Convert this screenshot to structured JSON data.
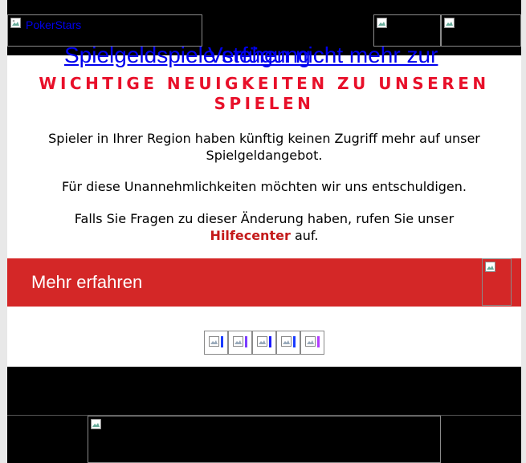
{
  "header": {
    "logo_alt": "PokerStars",
    "overlap_link_a": "Spielgeldspiele stehen nicht mehr zur",
    "overlap_link_b": "Verfügung"
  },
  "content": {
    "headline": "WICHTIGE NEUIGKEITEN ZU UNSEREN SPIELEN",
    "paragraph1": "Spieler in Ihrer Region haben künftig keinen Zugriff mehr auf unser Spielgeldangebot.",
    "paragraph2": "Für diese Unannehmlichkeiten möchten wir uns entschuldigen.",
    "paragraph3_before": "Falls Sie Fragen zu dieser Änderung haben, rufen Sie unser",
    "help_link": "Hilfecenter",
    "paragraph3_after": "auf."
  },
  "cta": {
    "label": "Mehr erfahren"
  },
  "social": {
    "icons": [
      "facebook-icon",
      "twitter-icon",
      "youtube-icon",
      "instagram-icon",
      "twitch-icon"
    ],
    "tail_colors": [
      "#1a3cff",
      "#7a3cff",
      "#1a1aff",
      "#1a3cff",
      "#b03cff"
    ]
  },
  "colors": {
    "accent_red": "#d42727",
    "headline_red": "#e8102a",
    "link_blue": "#0000ee"
  }
}
